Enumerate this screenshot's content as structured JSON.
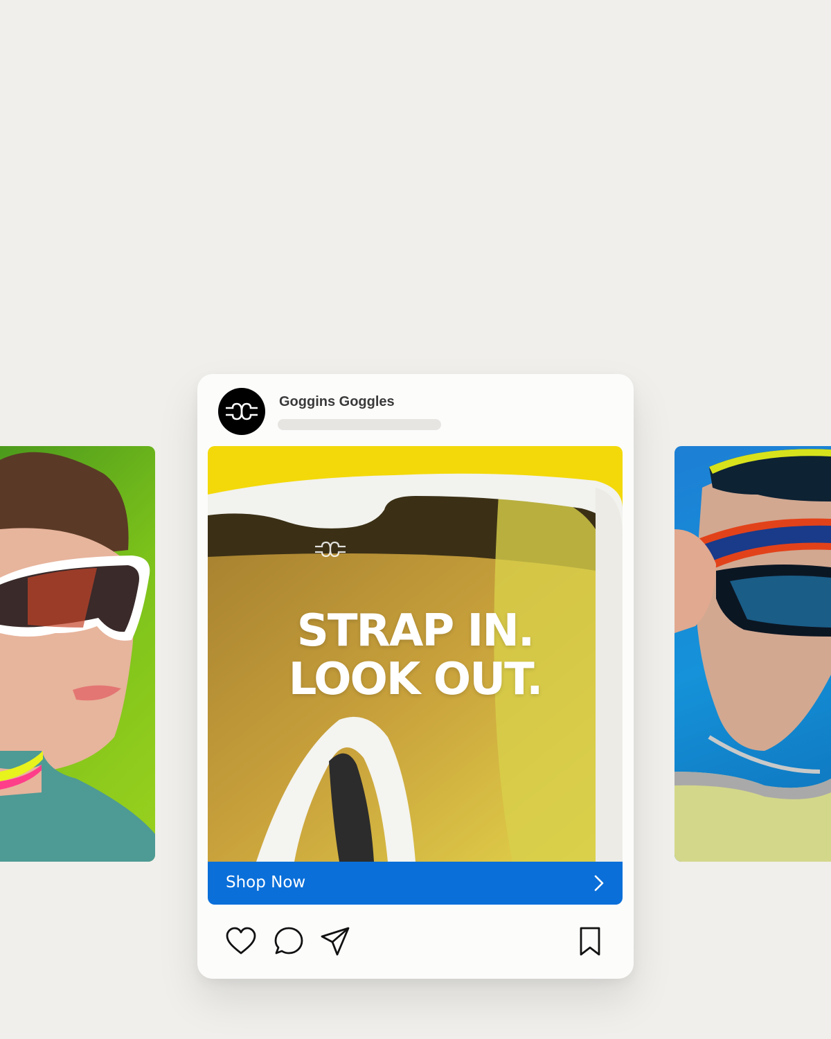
{
  "post": {
    "account_name": "Goggins Goggles",
    "headline_line1": "STRAP IN.",
    "headline_line2": "LOOK OUT.",
    "cta_label": "Shop Now"
  },
  "colors": {
    "page_background": "#f0efeb",
    "cta_blue": "#0a6fd9",
    "image_yellow": "#f3d90a",
    "left_card_green": "#7cc21b",
    "right_card_blue": "#1592d9"
  },
  "icons": {
    "avatar": "goggles-logo-icon",
    "like": "heart-icon",
    "comment": "comment-bubble-icon",
    "share": "paper-plane-icon",
    "save": "bookmark-icon",
    "cta": "chevron-right-icon"
  }
}
